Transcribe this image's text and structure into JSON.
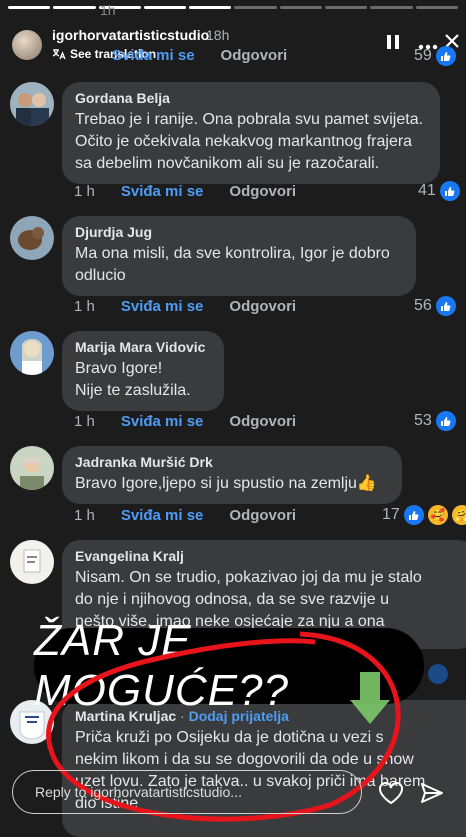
{
  "story": {
    "username": "igorhorvatartisticstudio",
    "time": "18h",
    "ghost_time": "1h",
    "see_translation": "See translation",
    "progress_bars": 10,
    "progress_done": 5
  },
  "top_meta": {
    "like": "Sviđa mi se",
    "reply": "Odgovori",
    "count": "59"
  },
  "comments": [
    {
      "name": "Gordana Belja",
      "lines": [
        "Trebao je i ranije. Ona pobrala svu pamet svijeta.",
        "Očito je očekivala nekakvog markantnog frajera",
        "sa debelim novčanikom ali su je razočarali."
      ],
      "time": "1 h",
      "like": "Sviđa mi se",
      "reply": "Odgovori",
      "count": "41"
    },
    {
      "name": "Djurdja Jug",
      "lines": [
        "Ma ona misli, da sve kontrolira, Igor je dobro",
        "odlucio"
      ],
      "time": "1 h",
      "like": "Sviđa mi se",
      "reply": "Odgovori",
      "count": "56"
    },
    {
      "name": "Marija Mara Vidovic",
      "lines": [
        "Bravo Igore!",
        "Nije te zaslužila."
      ],
      "time": "1 h",
      "like": "Sviđa mi se",
      "reply": "Odgovori",
      "count": "53"
    },
    {
      "name": "Jadranka Muršić Drk",
      "lines": [
        "Bravo Igore,ljepo si ju spustio na zemlju👍"
      ],
      "time": "1 h",
      "like": "Sviđa mi se",
      "reply": "Odgovori",
      "count": "17"
    },
    {
      "name": "Evangelina Kralj",
      "lines": [
        "Nisam. On se trudio, pokazivao joj da mu je stalo",
        "do nje i njihovog odnosa, da se sve razvije u",
        "nešto više, imao neke osjećaje za nju a ona"
      ]
    },
    {
      "name": "Martina Kruljac",
      "add_friend": "Dodaj prijatelja",
      "lines": [
        "Priča kruži po Osijeku da je dotična u vezi s",
        "nekim likom i da su se dogovorili da ode u show",
        "uzet lovu. Zato je takva.. u svakoj priči ima barem",
        "dio istine"
      ]
    }
  ],
  "sticker_text": "ŽAR JE MOGUĆE??",
  "reply_placeholder": "Reply to igorhorvatartisticstudio...",
  "colors": {
    "background": "#1c1c1d",
    "bubble": "#3a3b3c",
    "like_blue": "#4e9cf5",
    "annotation_red": "#e8141c",
    "arrow_green": "#7dc96b"
  }
}
